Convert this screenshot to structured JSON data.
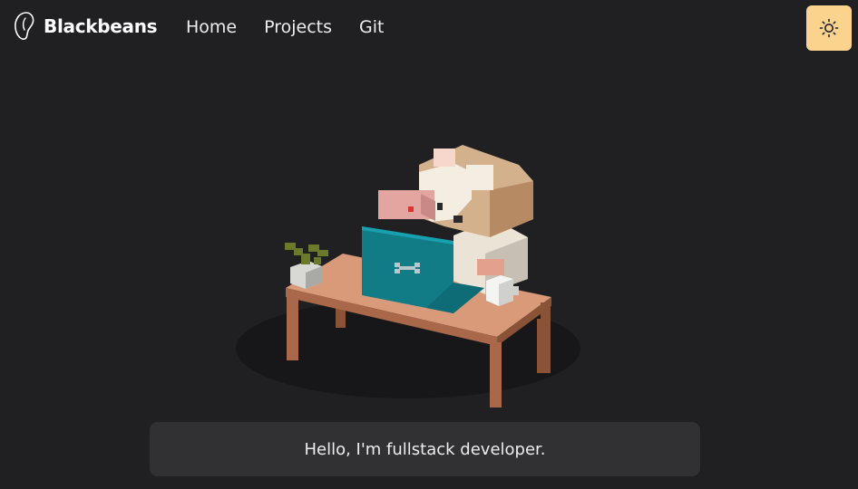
{
  "navbar": {
    "brand": "Blackbeans",
    "links": [
      {
        "label": "Home"
      },
      {
        "label": "Projects"
      },
      {
        "label": "Git"
      }
    ],
    "theme_toggle_icon": "sun-icon"
  },
  "hero": {
    "illustration": "voxel-dog-at-desk",
    "greeting": "Hello, I'm fullstack developer."
  },
  "colors": {
    "background": "#202023",
    "toggle_bg": "#fbd38d",
    "greeting_bg": "#313134",
    "desk": "#d89a78",
    "laptop": "#117b86"
  }
}
